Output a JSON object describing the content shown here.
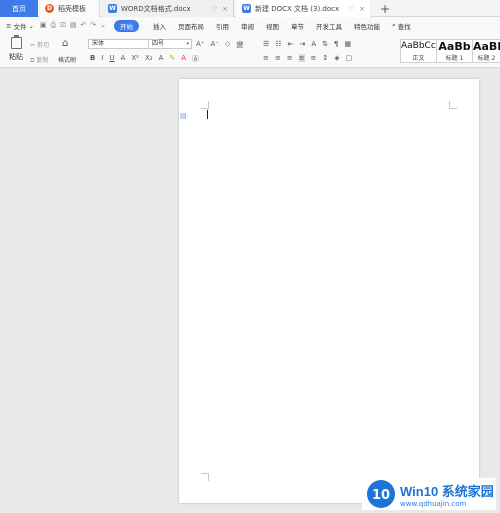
{
  "tabs": {
    "home": "首页",
    "template": "稻壳模板",
    "doc1": "WORD文档格式.docx",
    "doc2": "新建 DOCX 文档 (3).docx",
    "add": "+",
    "tab_tool_a": "♡",
    "tab_tool_b": "×"
  },
  "menu": {
    "file": "文件",
    "items": [
      "开始",
      "插入",
      "页面布局",
      "引用",
      "审阅",
      "视图",
      "章节",
      "开发工具",
      "特色功能"
    ],
    "search": "查找"
  },
  "ribbon": {
    "paste": "粘贴",
    "cut": "剪切",
    "copy": "复制",
    "format_painter": "格式刷",
    "font_name": "宋体",
    "font_size": "四号",
    "styles": [
      {
        "sample": "AaBbCcI",
        "caption": "正文"
      },
      {
        "sample": "AaBb",
        "caption": "标题 1"
      },
      {
        "sample": "AaBb",
        "caption": "标题 2"
      }
    ]
  },
  "watermark": {
    "brand": "Win10 系统家园",
    "url": "www.qdhuajin.com"
  },
  "colors": {
    "accent": "#3e7be8",
    "page": "#ffffff",
    "workspace": "#e9e9e9"
  }
}
